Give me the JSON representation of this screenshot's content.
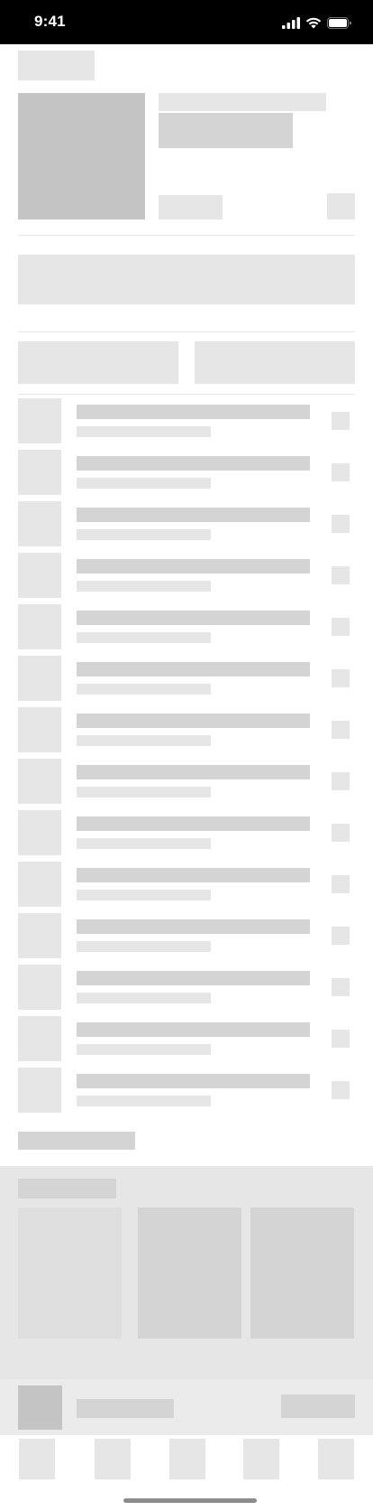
{
  "status_bar": {
    "time": "9:41",
    "icons": [
      "signal-icon",
      "wifi-icon",
      "battery-icon"
    ]
  },
  "colors": {
    "skeleton_light": "#e6e6e6",
    "skeleton_mid": "#d4d4d4",
    "skeleton_dark": "#c4c4c4",
    "status_bar_bg": "#000000"
  },
  "list_row_count": 14,
  "recommendation_card_count": 3,
  "tab_count": 5
}
